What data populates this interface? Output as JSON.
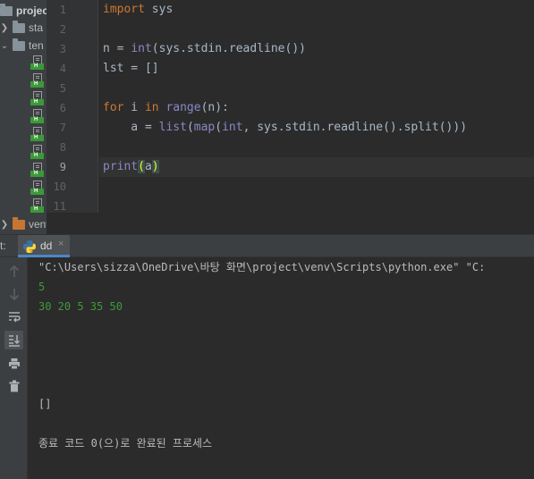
{
  "project_tree": {
    "root_label": "projec",
    "folders": [
      {
        "label": "sta",
        "expanded": false
      },
      {
        "label": "ten",
        "expanded": true
      }
    ],
    "file_badge": "H",
    "venv_label": "venv"
  },
  "editor": {
    "line_numbers": [
      "1",
      "2",
      "3",
      "4",
      "5",
      "6",
      "7",
      "8",
      "9",
      "10",
      "11"
    ],
    "current_line": "9",
    "code": {
      "l1_kw": "import",
      "l1_rest": " sys",
      "l3_a": "n = ",
      "l3_int": "int",
      "l3_b": "(sys.stdin.readline())",
      "l4": "lst = []",
      "l6_for": "for",
      "l6_a": " i ",
      "l6_in": "in",
      "l6_sp": " ",
      "l6_range": "range",
      "l6_b": "(n):",
      "l7_a": "    a = ",
      "l7_list": "list",
      "l7_p1": "(",
      "l7_map": "map",
      "l7_p2": "(",
      "l7_int": "int",
      "l7_b": ", sys.stdin.readline().split()))",
      "l9_print": "print",
      "l9_open": "(",
      "l9_arg": "a",
      "l9_close": ")"
    }
  },
  "run_panel": {
    "label": "t:",
    "tab_label": "dd",
    "tab_close": "×",
    "console_lines": [
      {
        "text": "\"C:\\Users\\sizza\\OneDrive\\바탕 화면\\project\\venv\\Scripts\\python.exe\" \"C:",
        "kind": "cmd"
      },
      {
        "text": "5",
        "kind": "input"
      },
      {
        "text": "30 20 5 35 50",
        "kind": "input"
      },
      {
        "text": "[]",
        "kind": "output"
      },
      {
        "text": "종료 코드 0(으)로 완료된 프로세스",
        "kind": "output"
      }
    ],
    "toolbar_icons": [
      "up-arrow-icon",
      "down-arrow-icon",
      "soft-wrap-icon",
      "scroll-to-end-icon",
      "print-icon",
      "trash-icon"
    ]
  },
  "colors": {
    "keyword": "#cc7832",
    "builtin": "#8888c6",
    "function": "#ffc66d",
    "console_input": "#3d9a3a",
    "tab_underline": "#4a88c7"
  }
}
